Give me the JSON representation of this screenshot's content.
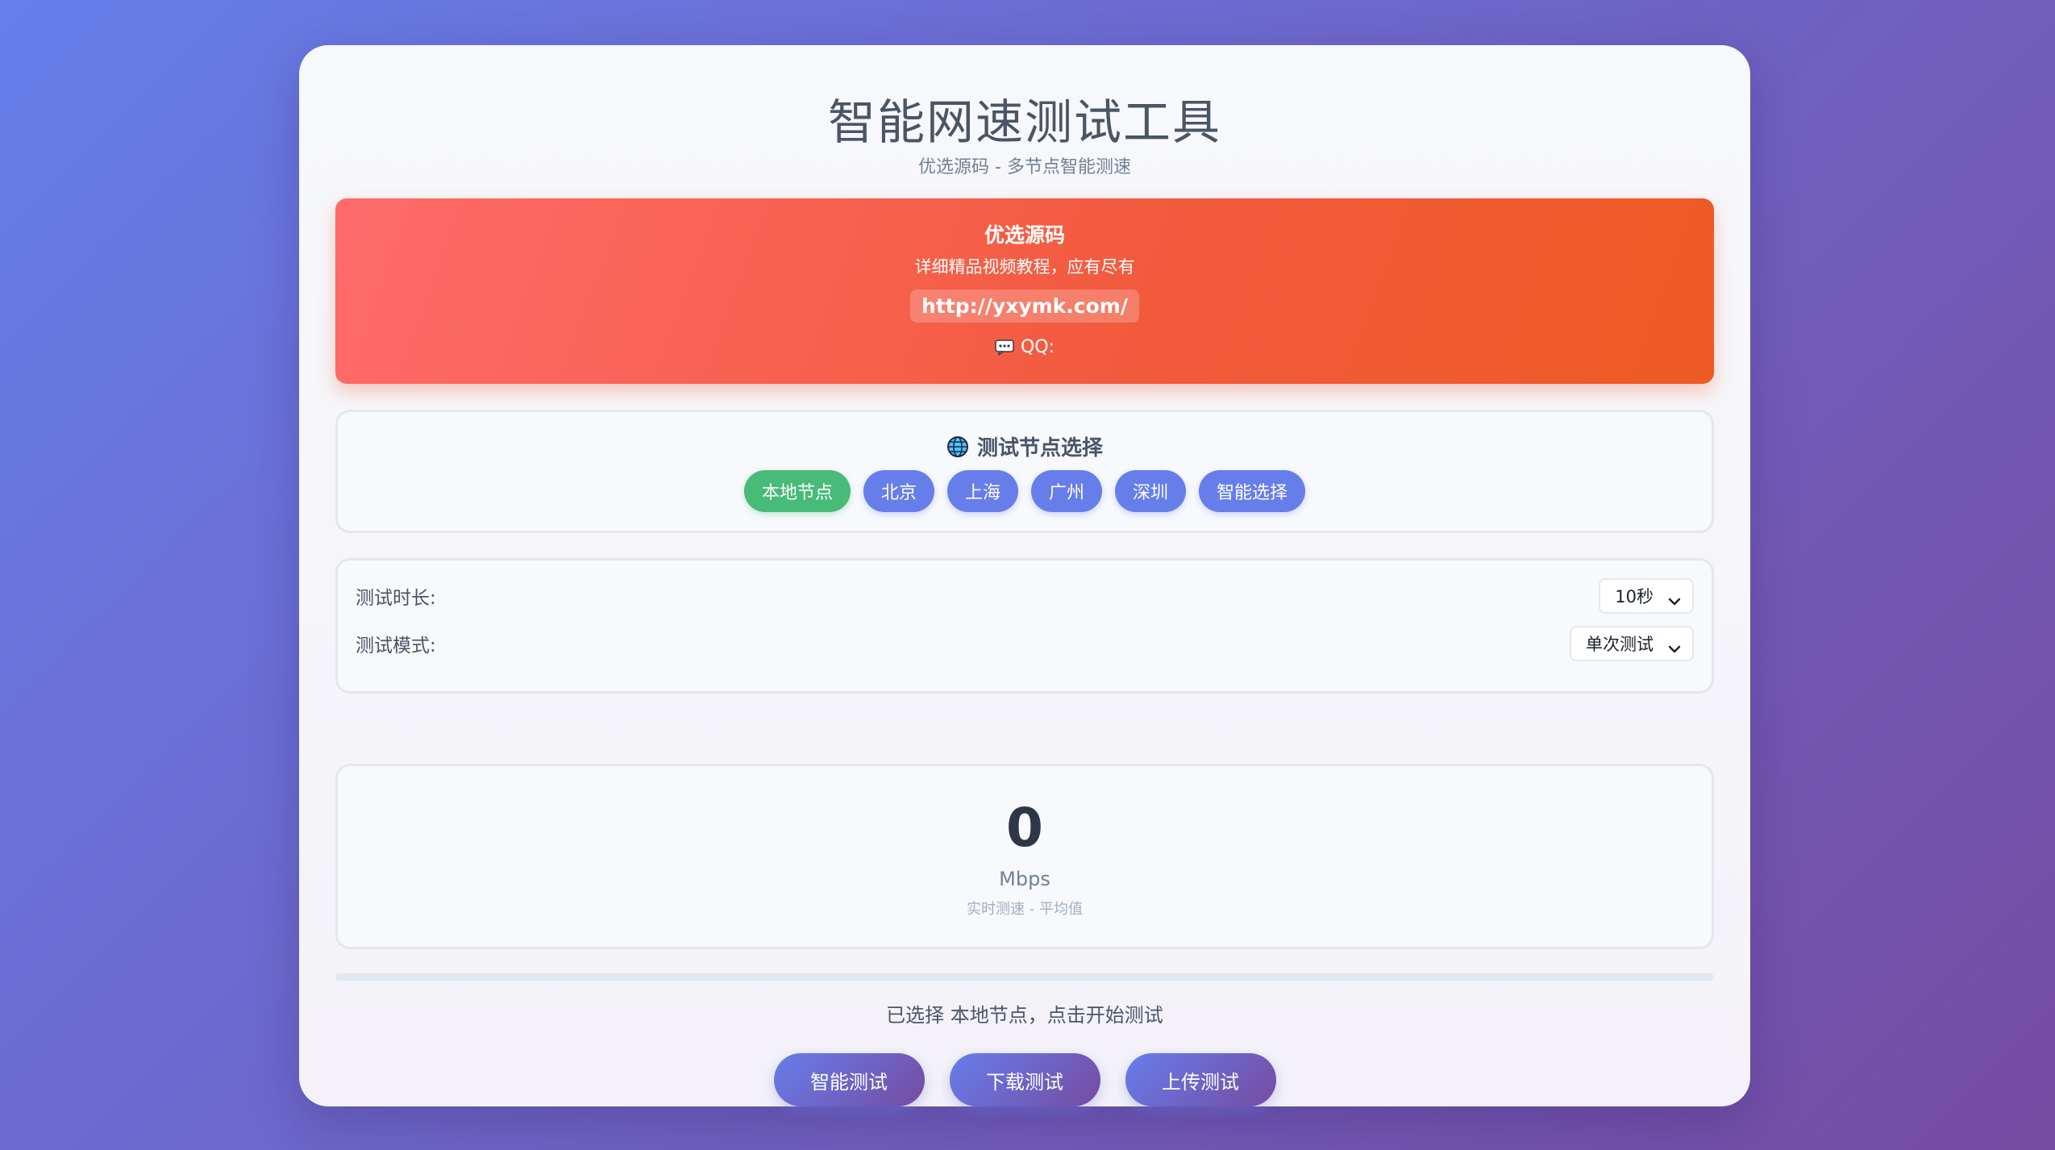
{
  "header": {
    "title": "智能网速测试工具",
    "subtitle": "优选源码 - 多节点智能测速"
  },
  "promo": {
    "title": "优选源码",
    "description": "详细精品视频教程，应有尽有",
    "link": "http://yxymk.com/",
    "qq_label": "QQ:",
    "qq_icon": "speech-balloon-icon"
  },
  "nodes": {
    "title": "测试节点选择",
    "title_icon": "globe-icon",
    "options": [
      "本地节点",
      "北京",
      "上海",
      "广州",
      "深圳",
      "智能选择"
    ],
    "selected": "本地节点"
  },
  "settings": {
    "duration_label": "测试时长:",
    "duration_value": "10秒",
    "mode_label": "测试模式:",
    "mode_value": "单次测试"
  },
  "speed": {
    "value": "0",
    "unit": "Mbps",
    "note": "实时测速 - 平均值"
  },
  "progress": {
    "percent": 0
  },
  "status": {
    "text": "已选择 本地节点，点击开始测试"
  },
  "actions": {
    "smart_test": "智能测试",
    "download_test": "下载测试",
    "upload_test": "上传测试"
  },
  "colors": {
    "background_start": "#667eea",
    "background_end": "#764ba2",
    "node_button": "#667eea",
    "node_button_active": "#48bb78",
    "promo_start": "#ff6b6b",
    "promo_end": "#ee5a24"
  }
}
